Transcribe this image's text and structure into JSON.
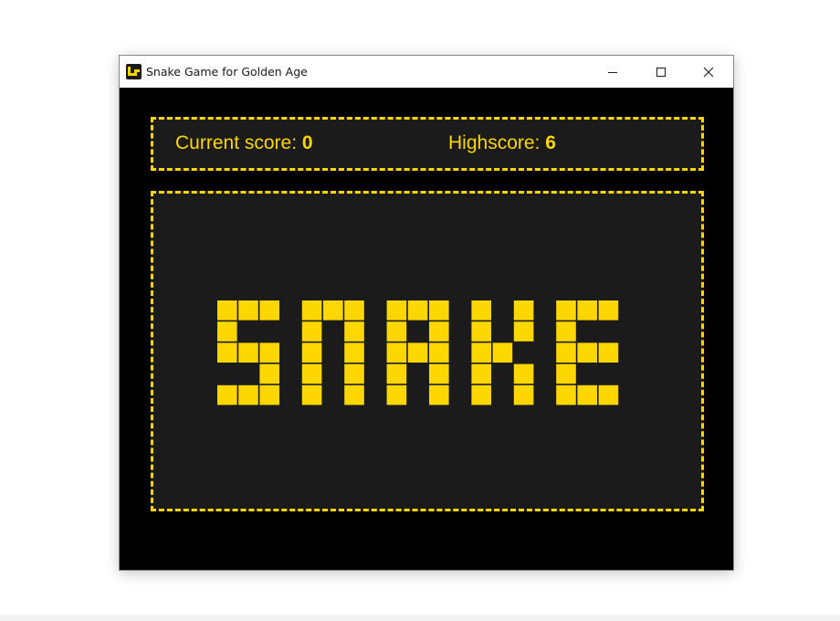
{
  "window": {
    "title": "Snake Game for Golden Age",
    "controls": {
      "minimize_icon": "minimize-icon",
      "maximize_icon": "maximize-icon",
      "close_icon": "close-icon"
    }
  },
  "scoreboard": {
    "current_label": "Current score:",
    "current_value": "0",
    "high_label": "Highscore:",
    "high_value": "6"
  },
  "game": {
    "logo_text": "SNAKE"
  },
  "colors": {
    "accent": "#ffd700",
    "panel_background": "#1b1b1b",
    "window_background": "#000000",
    "titlebar_background": "#ffffff"
  }
}
